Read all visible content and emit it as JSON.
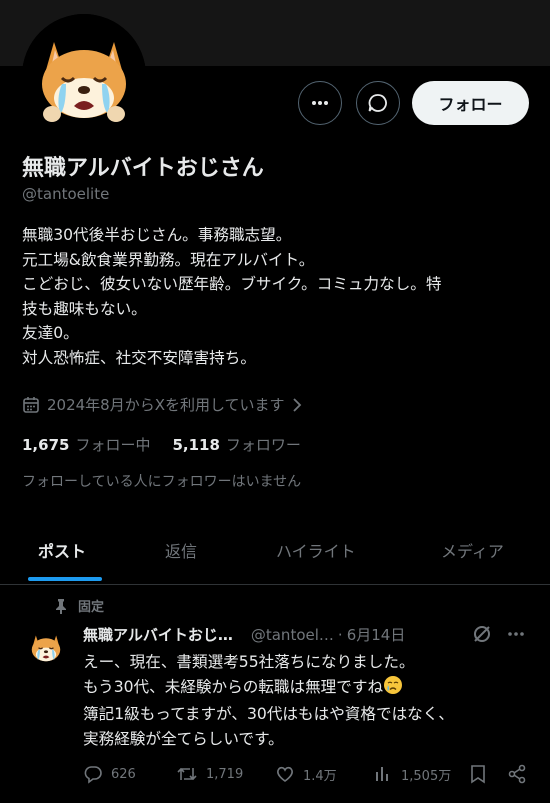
{
  "profile": {
    "name": "無職アルバイトおじさん",
    "handle": "@tantoelite",
    "bio_lines": [
      "無職30代後半おじさん。事務職志望。",
      "元工場&飲食業界勤務。現在アルバイト。",
      "こどおじ、彼女いない歴年齢。ブサイク。コミュ力なし。特",
      "技も趣味もない。",
      "友達0。",
      "対人恐怖症、社交不安障害持ち。"
    ],
    "joined": "2024年8月からXを利用しています",
    "following_count": "1,675",
    "following_label": "フォロー中",
    "followers_count": "5,118",
    "followers_label": "フォロワー",
    "no_mutual_followers": "フォローしている人にフォロワーはいません"
  },
  "header_actions": {
    "follow_label": "フォロー",
    "more_icon": "more-icon",
    "message_icon": "message-icon"
  },
  "tabs": [
    {
      "label": "ポスト",
      "active": true
    },
    {
      "label": "返信",
      "active": false
    },
    {
      "label": "ハイライト",
      "active": false
    },
    {
      "label": "メディア",
      "active": false
    }
  ],
  "post": {
    "pinned_label": "固定",
    "author_name": "無職アルバイトおじ…",
    "author_handle": "@tantoel…",
    "date": "6月14日",
    "text_lines": [
      "えー、現在、書類選考55社落ちになりました。",
      "もう30代、未経験からの転職は無理ですね",
      "簿記1級もってますが、30代はもはや資格ではなく、",
      "実務経験が全てらしいです。"
    ],
    "emoji": "crying-face",
    "replies": "626",
    "reposts": "1,719",
    "likes": "1.4万",
    "views": "1,505万"
  },
  "colors": {
    "background": "#000000",
    "text": "#e7e9ea",
    "muted": "#71767b",
    "accent": "#1d9bf0",
    "follow_button": "#eff3f4"
  }
}
